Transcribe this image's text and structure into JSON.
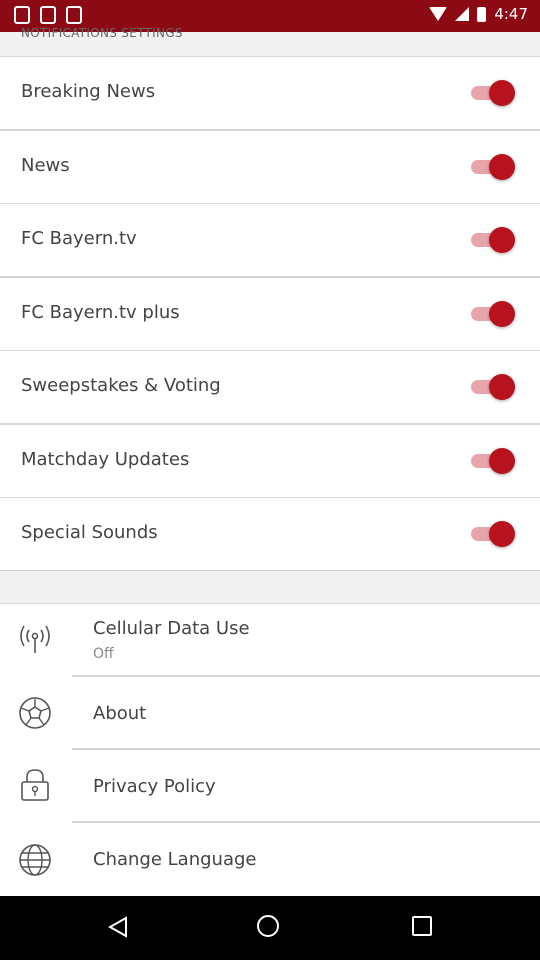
{
  "status_bar": {
    "time": "4:47"
  },
  "section_header": "NOTIFICATIONS SETTINGS",
  "toggles": [
    {
      "label": "Breaking News",
      "on": true
    },
    {
      "label": "News",
      "on": true
    },
    {
      "label": "FC Bayern.tv",
      "on": true
    },
    {
      "label": "FC Bayern.tv plus",
      "on": true
    },
    {
      "label": "Sweepstakes & Voting",
      "on": true
    },
    {
      "label": "Matchday Updates",
      "on": true
    },
    {
      "label": "Special Sounds",
      "on": true
    }
  ],
  "menu": [
    {
      "label": "Cellular Data Use",
      "sub": "Off",
      "icon": "antenna-icon"
    },
    {
      "label": "About",
      "icon": "soccer-ball-icon"
    },
    {
      "label": "Privacy Policy",
      "icon": "lock-icon"
    },
    {
      "label": "Change Language",
      "icon": "globe-icon"
    }
  ],
  "colors": {
    "status_bar": "#8b0a14",
    "switch_thumb": "#b8121e",
    "switch_track": "#e8a5a9"
  }
}
